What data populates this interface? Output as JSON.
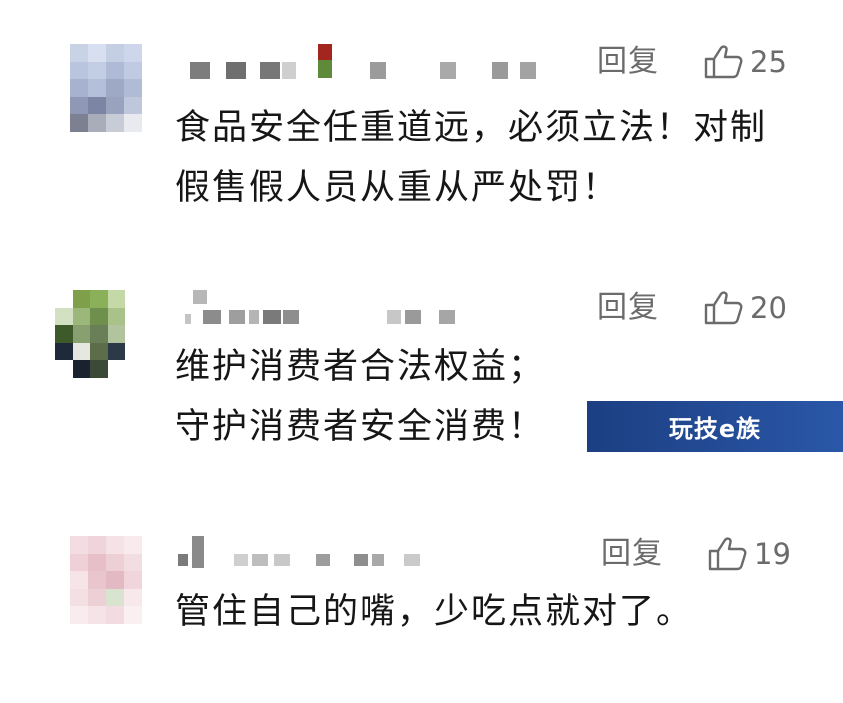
{
  "comments": [
    {
      "reply_label": "回复",
      "like_count": "25",
      "lines": [
        "食品安全任重道远，必须立法！对制",
        "假售假人员从重从严处罚！"
      ]
    },
    {
      "reply_label": "回复",
      "like_count": "20",
      "lines": [
        "维护消费者合法权益；",
        "守护消费者安全消费！"
      ]
    },
    {
      "reply_label": "回复",
      "like_count": "19",
      "lines": [
        "管住自己的嘴，少吃点就对了。"
      ]
    }
  ],
  "watermark": {
    "text": "玩技e族"
  },
  "icons": {
    "like": "thumbs-up-icon",
    "avatar": "avatar-image"
  },
  "colors": {
    "meta_text": "#6b6b6b",
    "body_text": "#161616",
    "watermark_bg": "#1c3f82"
  }
}
